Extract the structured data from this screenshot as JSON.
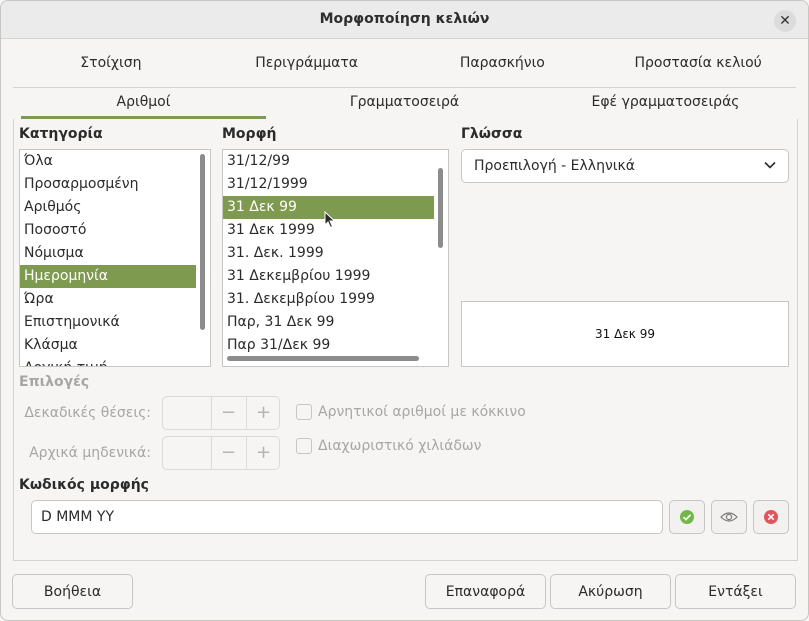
{
  "dialog": {
    "title": "Μορφοποίηση κελιών"
  },
  "tabs_row1": [
    {
      "label": "Στοίχιση"
    },
    {
      "label": "Περιγράμματα"
    },
    {
      "label": "Παρασκήνιο"
    },
    {
      "label": "Προστασία κελιού"
    }
  ],
  "tabs_row2": [
    {
      "label": "Αριθμοί",
      "active": true
    },
    {
      "label": "Γραμματοσειρά"
    },
    {
      "label": "Εφέ γραμματοσειράς"
    }
  ],
  "category": {
    "label": "Κατηγορία",
    "items": [
      "Όλα",
      "Προσαρμοσμένη",
      "Αριθμός",
      "Ποσοστό",
      "Νόμισμα",
      "Ημερομηνία",
      "Ώρα",
      "Επιστημονικά",
      "Κλάσμα",
      "Λογική τιμή"
    ],
    "selected": "Ημερομηνία"
  },
  "format": {
    "label": "Μορφή",
    "items": [
      "31/12/99",
      "31/12/1999",
      "31 Δεκ 99",
      "31 Δεκ 1999",
      "31. Δεκ. 1999",
      "31 Δεκεμβρίου 1999",
      "31. Δεκεμβρίου 1999",
      "Παρ, 31 Δεκ 99",
      "Παρ 31/Δεκ 99"
    ],
    "selected": "31 Δεκ 99"
  },
  "language": {
    "label": "Γλώσσα",
    "value": "Προεπιλογή - Ελληνικά"
  },
  "preview": {
    "text": "31 Δεκ 99"
  },
  "options": {
    "label": "Επιλογές",
    "decimal_places_label": "Δεκαδικές θέσεις:",
    "leading_zeros_label": "Αρχικά μηδενικά:",
    "minus": "−",
    "plus": "+",
    "negative_red_label": "Αρνητικοί αριθμοί με κόκκινο",
    "thousands_sep_label": "Διαχωριστικό χιλιάδων"
  },
  "format_code": {
    "label": "Κωδικός μορφής",
    "value": "D MMM YY"
  },
  "buttons": {
    "help": "Βοήθεια",
    "reset": "Επαναφορά",
    "cancel": "Ακύρωση",
    "ok": "Εντάξει"
  },
  "colors": {
    "accent": "#7d9a4e",
    "ok_icon": "#73b74a",
    "delete_icon": "#e2545b"
  }
}
